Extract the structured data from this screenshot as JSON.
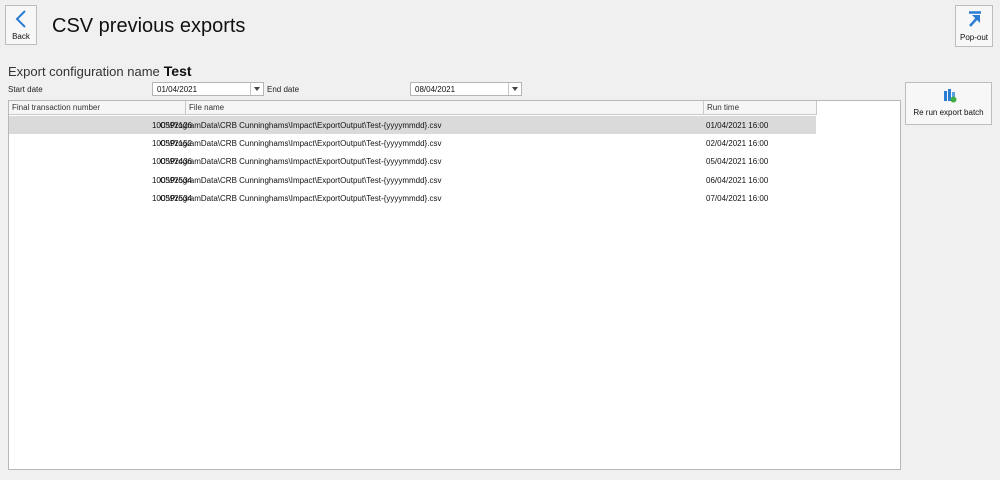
{
  "toolbar": {
    "back_label": "Back",
    "popout_label": "Pop-out"
  },
  "page": {
    "title": "CSV previous exports"
  },
  "config": {
    "label": "Export configuration name",
    "value": "Test"
  },
  "filters": {
    "start_label": "Start date",
    "start_value": "01/04/2021",
    "end_label": "End date",
    "end_value": "08/04/2021"
  },
  "actions": {
    "rerun_label": "Re run export batch"
  },
  "grid": {
    "columns": [
      "Final transaction number",
      "File name",
      "Run time"
    ],
    "rows": [
      {
        "number": "100592126",
        "file": "C:\\ProgramData\\CRB Cunninghams\\Impact\\ExportOutput\\Test-{yyyymmdd}.csv",
        "time": "01/04/2021 16:00"
      },
      {
        "number": "100592152",
        "file": "C:\\ProgramData\\CRB Cunninghams\\Impact\\ExportOutput\\Test-{yyyymmdd}.csv",
        "time": "02/04/2021 16:00"
      },
      {
        "number": "100592436",
        "file": "C:\\ProgramData\\CRB Cunninghams\\Impact\\ExportOutput\\Test-{yyyymmdd}.csv",
        "time": "05/04/2021 16:00"
      },
      {
        "number": "100592534",
        "file": "C:\\ProgramData\\CRB Cunninghams\\Impact\\ExportOutput\\Test-{yyyymmdd}.csv",
        "time": "06/04/2021 16:00"
      },
      {
        "number": "100592534",
        "file": "C:\\ProgramData\\CRB Cunninghams\\Impact\\ExportOutput\\Test-{yyyymmdd}.csv",
        "time": "07/04/2021 16:00"
      }
    ]
  },
  "colors": {
    "accent": "#2b7cd3",
    "selected_row": "#dadada"
  },
  "icons": {
    "back": "chevron-left-icon",
    "popout": "popout-arrow-icon",
    "rerun": "export-batch-icon",
    "dropdown": "chevron-down-icon"
  }
}
